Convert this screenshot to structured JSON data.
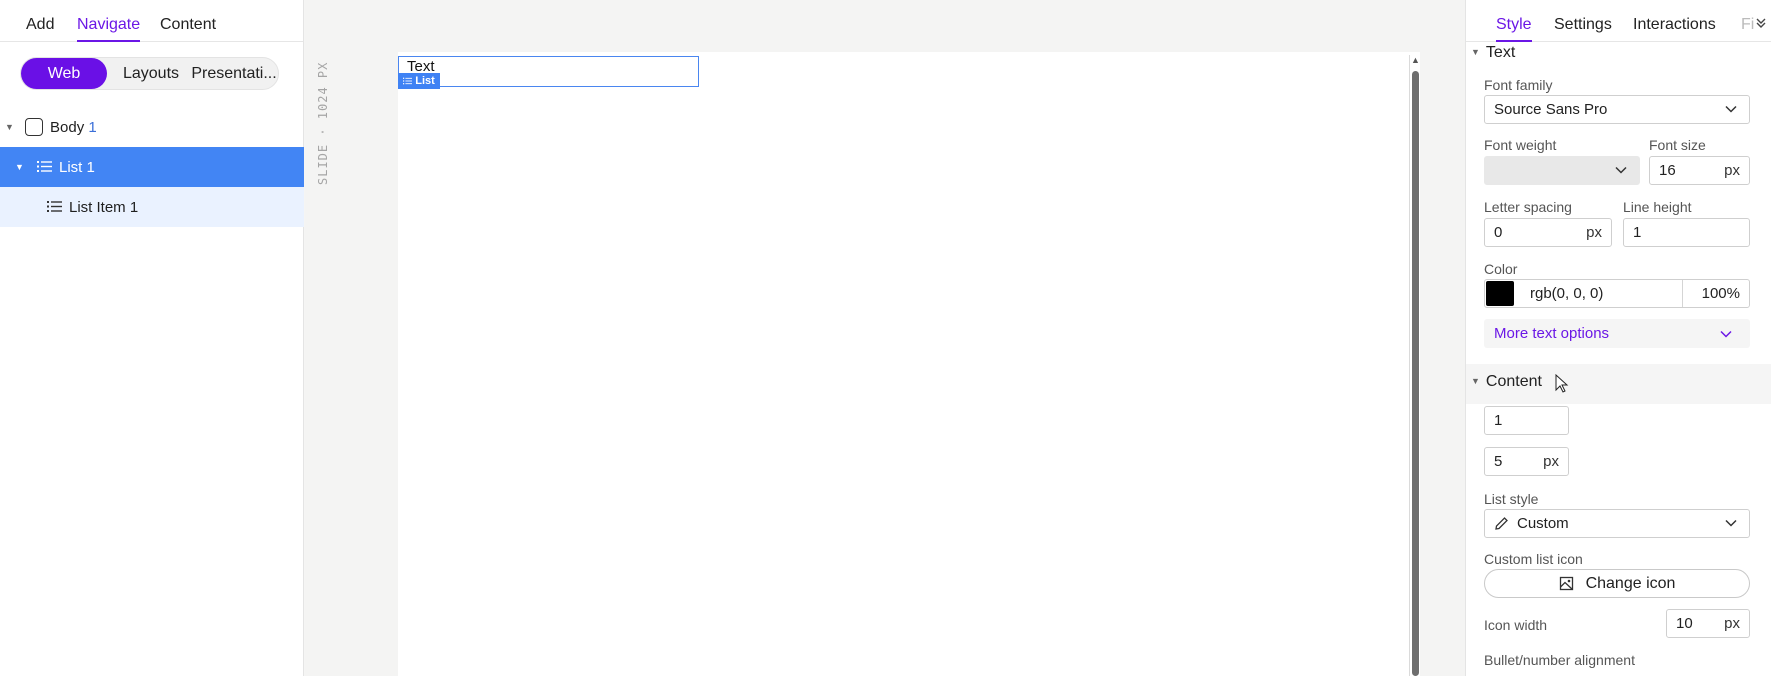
{
  "left_panel": {
    "tabs": [
      {
        "label": "Add"
      },
      {
        "label": "Navigate",
        "active": true
      },
      {
        "label": "Content"
      }
    ],
    "segments": [
      {
        "label": "Web",
        "selected": true
      },
      {
        "label": "Layouts"
      },
      {
        "label": "Presentati..."
      }
    ],
    "tree": {
      "body_label": "Body",
      "body_num": "1",
      "list_label": "List 1",
      "list_item_label": "List Item 1"
    }
  },
  "canvas": {
    "ruler_label": "SLIDE · 1024 PX",
    "selected_text": "Text",
    "selection_tag": "List"
  },
  "right_panel": {
    "tabs": [
      {
        "label": "Style",
        "active": true
      },
      {
        "label": "Settings"
      },
      {
        "label": "Interactions"
      },
      {
        "label": "Fi"
      }
    ],
    "text_section": {
      "title": "Text",
      "font_family_label": "Font family",
      "font_family_value": "Source Sans Pro",
      "font_weight_label": "Font weight",
      "font_weight_value": "",
      "font_size_label": "Font size",
      "font_size_value": "16",
      "font_size_unit": "px",
      "letter_spacing_label": "Letter spacing",
      "letter_spacing_value": "0",
      "letter_spacing_unit": "px",
      "line_height_label": "Line height",
      "line_height_value": "1",
      "color_label": "Color",
      "color_swatch": "#000000",
      "color_value": "rgb(0, 0, 0)",
      "color_opacity": "100%",
      "more_options": "More text options"
    },
    "content_section": {
      "title": "Content",
      "field1_value": "1",
      "field2_value": "5",
      "field2_unit": "px",
      "list_style_label": "List style",
      "list_style_value": "Custom",
      "custom_icon_label": "Custom list icon",
      "change_icon_button": "Change icon",
      "icon_width_label": "Icon width",
      "icon_width_value": "10",
      "icon_width_unit": "px",
      "bullet_alignment_label": "Bullet/number alignment"
    }
  },
  "colors": {
    "accent": "#6b17e6",
    "selection_blue": "#4285f4"
  }
}
